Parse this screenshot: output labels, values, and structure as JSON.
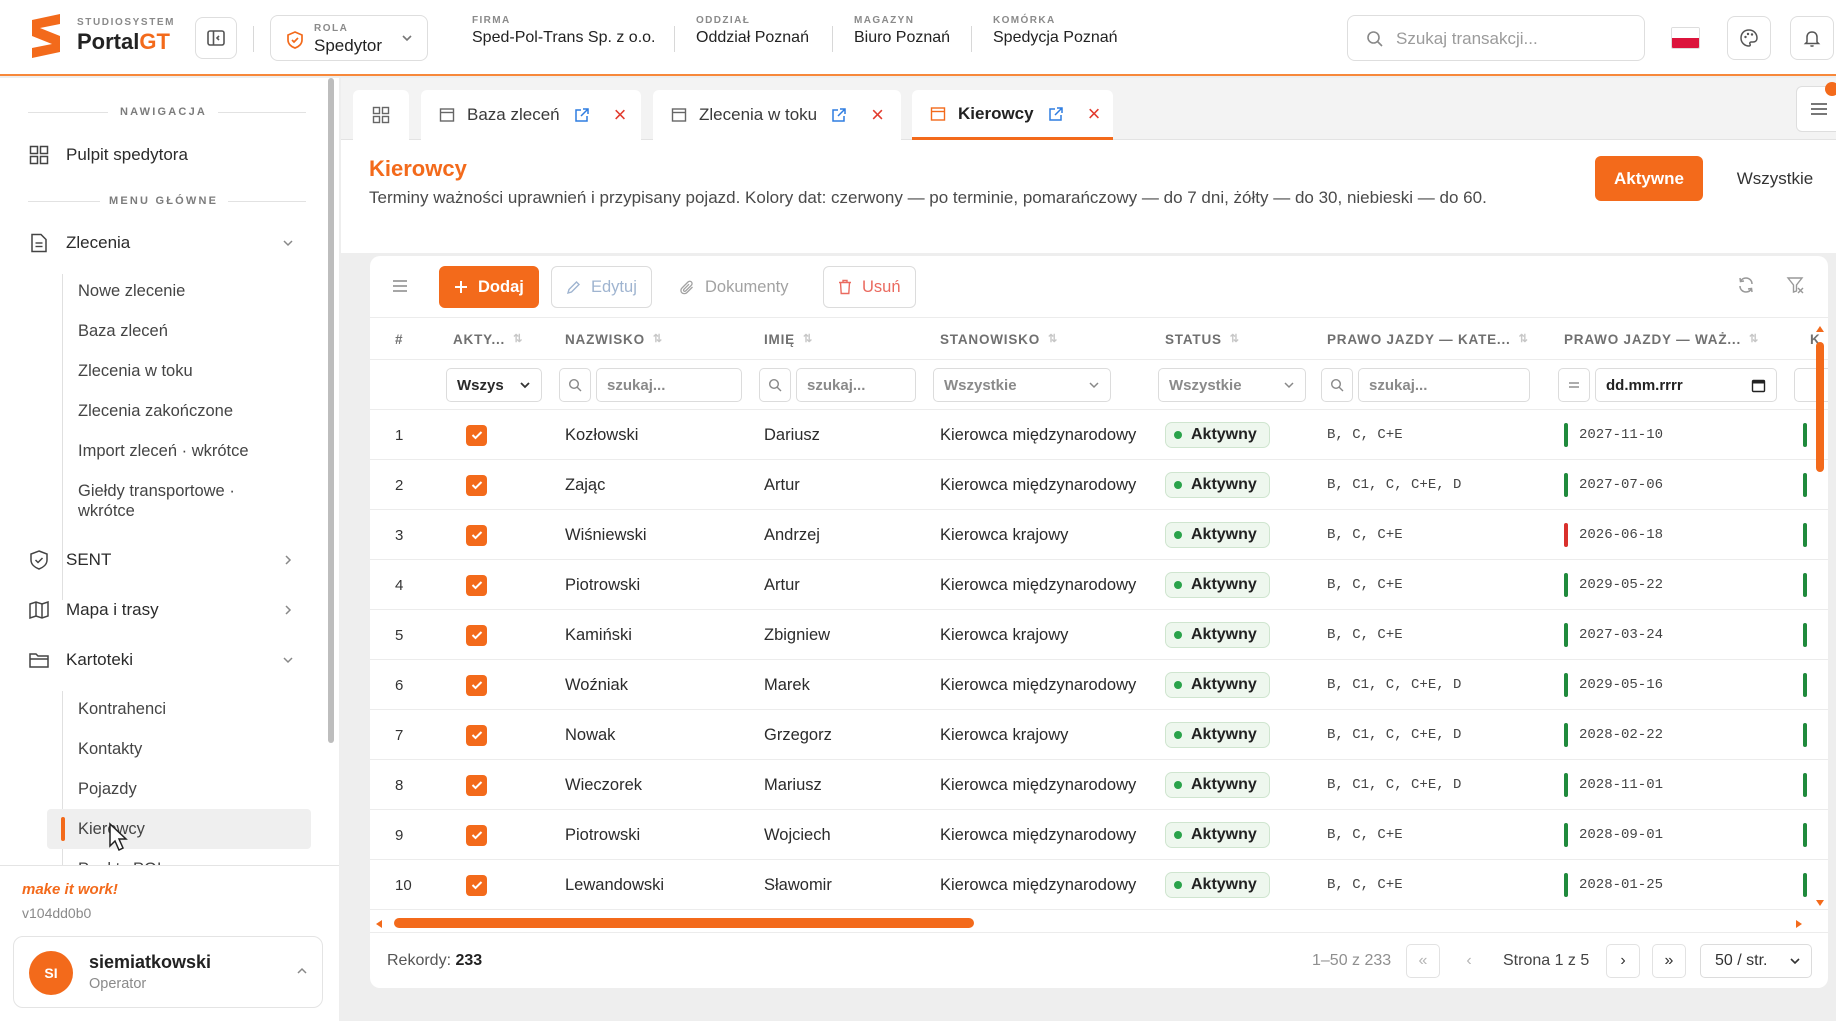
{
  "brand": {
    "small": "STUDIOSYSTEM",
    "name_main": "Portal",
    "name_accent": "GT"
  },
  "role": {
    "label": "ROLA",
    "value": "Spedytor"
  },
  "context": [
    {
      "label": "FIRMA",
      "value": "Sped-Pol-Trans Sp. z o.o."
    },
    {
      "label": "ODDZIAŁ",
      "value": "Oddział Poznań"
    },
    {
      "label": "MAGAZYN",
      "value": "Biuro Poznań"
    },
    {
      "label": "KOMÓRKA",
      "value": "Spedycja Poznań"
    }
  ],
  "search": {
    "placeholder": "Szukaj transakcji..."
  },
  "sidebar": {
    "section_nav": "NAWIGACJA",
    "dashboard": "Pulpit spedytora",
    "section_menu": "MENU GŁÓWNE",
    "groups": [
      {
        "label": "Zlecenia",
        "icon": "document-icon",
        "expanded": true,
        "items": [
          "Nowe zlecenie",
          "Baza zleceń",
          "Zlecenia w toku",
          "Zlecenia zakończone",
          "Import zleceń · wkrótce",
          "Giełdy transportowe · wkrótce"
        ]
      },
      {
        "label": "SENT",
        "icon": "shield-icon",
        "expanded": false
      },
      {
        "label": "Mapa i trasy",
        "icon": "map-icon",
        "expanded": false
      },
      {
        "label": "Kartoteki",
        "icon": "folder-icon",
        "expanded": true,
        "items": [
          "Kontrahenci",
          "Kontakty",
          "Pojazdy",
          "Kierowcy",
          "Punkty POI"
        ]
      }
    ],
    "motto": "make it work!",
    "version": "v104dd0b0",
    "user": {
      "initials": "SI",
      "name": "siemiatkowski",
      "role": "Operator"
    }
  },
  "tabs": [
    {
      "label": "Baza zleceń",
      "active": false
    },
    {
      "label": "Zlecenia w toku",
      "active": false
    },
    {
      "label": "Kierowcy",
      "active": true
    }
  ],
  "page": {
    "title": "Kierowcy",
    "description": "Terminy ważności uprawnień i przypisany pojazd. Kolory dat: czerwony — po terminie, pomarańczowy — do 7 dni, żółty — do 30, niebieski — do 60.",
    "filter_active": "Aktywne",
    "filter_all": "Wszystkie"
  },
  "toolbar": {
    "add": "Dodaj",
    "edit": "Edytuj",
    "documents": "Dokumenty",
    "delete": "Usuń"
  },
  "table": {
    "columns": [
      "#",
      "AKTY...",
      "NAZWISKO",
      "IMIĘ",
      "STANOWISKO",
      "STATUS",
      "PRAWO JAZDY — KATE...",
      "PRAWO JAZDY — WAŻ...",
      "K"
    ],
    "filters": {
      "active": "Wszys",
      "search_ph": "szukaj...",
      "position": "Wszystkie",
      "status": "Wszystkie",
      "date_ph": "dd.mm.rrrr"
    },
    "rows": [
      {
        "n": "1",
        "surname": "Kozłowski",
        "name": "Dariusz",
        "position": "Kierowca międzynarodowy",
        "status": "Aktywny",
        "categories": "B, C, C+E",
        "license_valid": "2027-11-10",
        "date_color": "#1f8a3c"
      },
      {
        "n": "2",
        "surname": "Zając",
        "name": "Artur",
        "position": "Kierowca międzynarodowy",
        "status": "Aktywny",
        "categories": "B, C1, C, C+E, D",
        "license_valid": "2027-07-06",
        "date_color": "#1f8a3c"
      },
      {
        "n": "3",
        "surname": "Wiśniewski",
        "name": "Andrzej",
        "position": "Kierowca krajowy",
        "status": "Aktywny",
        "categories": "B, C, C+E",
        "license_valid": "2026-06-18",
        "date_color": "#d9302c"
      },
      {
        "n": "4",
        "surname": "Piotrowski",
        "name": "Artur",
        "position": "Kierowca międzynarodowy",
        "status": "Aktywny",
        "categories": "B, C, C+E",
        "license_valid": "2029-05-22",
        "date_color": "#1f8a3c"
      },
      {
        "n": "5",
        "surname": "Kamiński",
        "name": "Zbigniew",
        "position": "Kierowca krajowy",
        "status": "Aktywny",
        "categories": "B, C, C+E",
        "license_valid": "2027-03-24",
        "date_color": "#1f8a3c"
      },
      {
        "n": "6",
        "surname": "Woźniak",
        "name": "Marek",
        "position": "Kierowca międzynarodowy",
        "status": "Aktywny",
        "categories": "B, C1, C, C+E, D",
        "license_valid": "2029-05-16",
        "date_color": "#1f8a3c"
      },
      {
        "n": "7",
        "surname": "Nowak",
        "name": "Grzegorz",
        "position": "Kierowca krajowy",
        "status": "Aktywny",
        "categories": "B, C1, C, C+E, D",
        "license_valid": "2028-02-22",
        "date_color": "#1f8a3c"
      },
      {
        "n": "8",
        "surname": "Wieczorek",
        "name": "Mariusz",
        "position": "Kierowca międzynarodowy",
        "status": "Aktywny",
        "categories": "B, C1, C, C+E, D",
        "license_valid": "2028-11-01",
        "date_color": "#1f8a3c"
      },
      {
        "n": "9",
        "surname": "Piotrowski",
        "name": "Wojciech",
        "position": "Kierowca międzynarodowy",
        "status": "Aktywny",
        "categories": "B, C, C+E",
        "license_valid": "2028-09-01",
        "date_color": "#1f8a3c"
      },
      {
        "n": "10",
        "surname": "Lewandowski",
        "name": "Sławomir",
        "position": "Kierowca międzynarodowy",
        "status": "Aktywny",
        "categories": "B, C, C+E",
        "license_valid": "2028-01-25",
        "date_color": "#1f8a3c"
      }
    ]
  },
  "footer": {
    "records_label": "Rekordy:",
    "records_count": "233",
    "range": "1–50 z 233",
    "page": "Strona 1 z 5",
    "per_page": "50 / str."
  },
  "colors": {
    "accent": "#f36a1b",
    "ok": "#1f8a3c",
    "expired": "#d9302c"
  }
}
